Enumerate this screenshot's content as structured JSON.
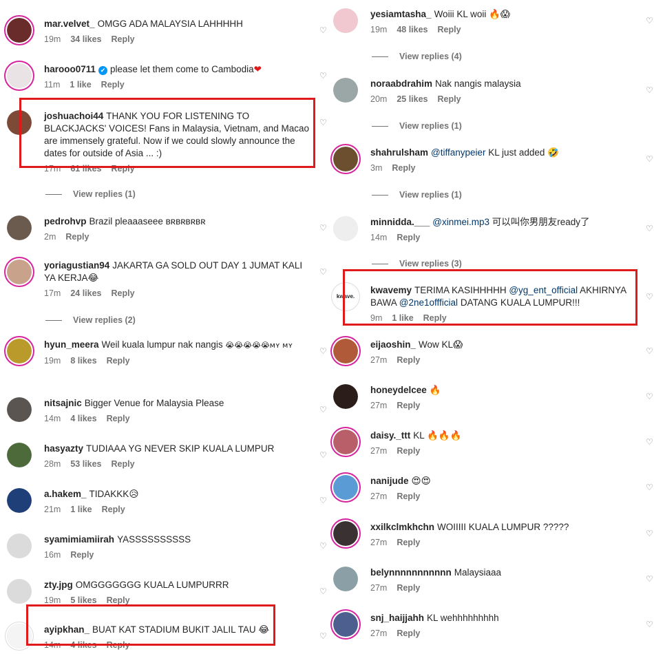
{
  "left_comments": [
    {
      "user": "mar.velvet_",
      "text": "OMGG ADA MALAYSIA LAHHHHH",
      "time": "19m",
      "likes": "34 likes",
      "reply": "Reply",
      "avatar_color": "#6a2b2b"
    },
    {
      "user": "harooo0711",
      "verified": "✔",
      "text": "please let them come to Cambodia",
      "emoji": "❤",
      "time": "11m",
      "likes": "1 like",
      "reply": "Reply",
      "avatar_color": "#e9e3e6"
    },
    {
      "user": "joshuachoi44",
      "text": "THANK YOU FOR LISTENING TO BLACKJACKS' VOICES! Fans in Malaysia, Vietnam, and Macao are immensely grateful. Now if we could slowly announce the dates for outside of Asia ... :)",
      "time": "17m",
      "likes": "61 likes",
      "reply": "Reply",
      "avatar_color": "#7c4a37"
    },
    {
      "user": "pedrohvp",
      "text": "Brazil pleaaaseee ʙʀʙʀʙʀʙʀ",
      "time": "2m",
      "likes": "",
      "reply": "Reply",
      "avatar_color": "#6b5a4e"
    },
    {
      "user": "yoriagustian94",
      "text": "JAKARTA GA SOLD OUT DAY 1 JUMAT KALI YA KERJA",
      "emoji": "😂",
      "time": "17m",
      "likes": "24 likes",
      "reply": "Reply",
      "avatar_color": "#c9a28c"
    },
    {
      "user": "hyun_meera",
      "text": "Weil kuala lumpur nak nangis",
      "emoji": "😭😭😭😭😭ᴍʏ ᴍʏ",
      "time": "19m",
      "likes": "8 likes",
      "reply": "Reply",
      "avatar_color": "#b99a2a"
    },
    {
      "user": "nitsajnic",
      "text": "Bigger Venue for Malaysia Please",
      "time": "14m",
      "likes": "4 likes",
      "reply": "Reply",
      "avatar_color": "#5a5550"
    },
    {
      "user": "hasyazty",
      "text": "TUDIAAA YG NEVER SKIP KUALA LUMPUR",
      "time": "28m",
      "likes": "53 likes",
      "reply": "Reply",
      "avatar_color": "#4d6a3a"
    },
    {
      "user": "a.hakem_",
      "text": "TIDAKKK",
      "emoji": "😥",
      "time": "21m",
      "likes": "1 like",
      "reply": "Reply",
      "avatar_color": "#1f3f78"
    },
    {
      "user": "syamimiamiirah",
      "text": "YASSSSSSSSSS",
      "time": "16m",
      "likes": "",
      "reply": "Reply",
      "avatar_color": "#dbdbdb"
    },
    {
      "user": "zty.jpg",
      "text": "OMGGGGGGG KUALA LUMPURRR",
      "time": "19m",
      "likes": "5 likes",
      "reply": "Reply",
      "avatar_color": "#dbdbdb"
    },
    {
      "user": "ayipkhan_",
      "text": "BUAT KAT STADIUM BUKIT JALIL TAU",
      "emoji": "😂",
      "time": "14m",
      "likes": "4 likes",
      "reply": "Reply",
      "avatar_color": "#f4f4f4"
    }
  ],
  "left_view_replies": [
    "View replies (1)",
    "View replies (2)"
  ],
  "right_comments": [
    {
      "user": "yesiamtasha_",
      "text": "Woiii KL woii",
      "emoji": "🔥😱",
      "time": "19m",
      "likes": "48 likes",
      "reply": "Reply",
      "avatar_color": "#f1c8cf"
    },
    {
      "user": "noraabdrahim",
      "text": "Nak nangis malaysia",
      "time": "20m",
      "likes": "25 likes",
      "reply": "Reply",
      "avatar_color": "#9aa7a6"
    },
    {
      "user": "shahrulsham",
      "mention": "@tiffanypeier",
      "text": "KL just added",
      "emoji": "🤣",
      "time": "3m",
      "likes": "",
      "reply": "Reply",
      "avatar_color": "#6b4f2e"
    },
    {
      "user": "minnidda.___",
      "mention": "@xinmei.mp3",
      "text": "可以叫你男朋友ready了",
      "time": "14m",
      "likes": "",
      "reply": "Reply",
      "avatar_color": "#eeeeee"
    },
    {
      "user": "kwavemy",
      "text_a": "TERIMA KASIHHHHH",
      "mention_a": "@yg_ent_official",
      "text_b": "AKHIRNYA BAWA",
      "mention_b": "@2ne1offficial",
      "text_c": "DATANG KUALA LUMPUR!!!",
      "time": "9m",
      "likes": "1 like",
      "reply": "Reply",
      "avatar_label": "kwave.",
      "avatar_color": "#ffffff"
    },
    {
      "user": "eijaoshin_",
      "text": "Wow KL",
      "emoji": "😱",
      "time": "27m",
      "likes": "",
      "reply": "Reply",
      "avatar_color": "#b05a3a"
    },
    {
      "user": "honeydelcee",
      "text": "",
      "emoji": "🔥",
      "time": "27m",
      "likes": "",
      "reply": "Reply",
      "avatar_color": "#2a1d1a"
    },
    {
      "user": "daisy._ttt",
      "text": "KL",
      "emoji": "🔥🔥🔥",
      "time": "27m",
      "likes": "",
      "reply": "Reply",
      "avatar_color": "#b95f6a"
    },
    {
      "user": "nanijude",
      "text": "",
      "emoji": "😍😍",
      "time": "27m",
      "likes": "",
      "reply": "Reply",
      "avatar_color": "#5b9bd5"
    },
    {
      "user": "xxilkclmkhchn",
      "text": "WOIIIII KUALA LUMPUR ?????",
      "time": "27m",
      "likes": "",
      "reply": "Reply",
      "avatar_color": "#3a3232"
    },
    {
      "user": "belynnnnnnnnnnn",
      "text": "Malaysiaaa",
      "time": "27m",
      "likes": "",
      "reply": "Reply",
      "avatar_color": "#8aa0a6"
    },
    {
      "user": "snj_haijjahh",
      "text": "KL wehhhhhhhhh",
      "time": "27m",
      "likes": "",
      "reply": "Reply",
      "avatar_color": "#4d5f8f"
    }
  ],
  "right_view_replies": [
    "View replies (4)",
    "View replies (1)",
    "View replies (1)",
    "View replies (3)"
  ],
  "accent_color": "#e0191a"
}
